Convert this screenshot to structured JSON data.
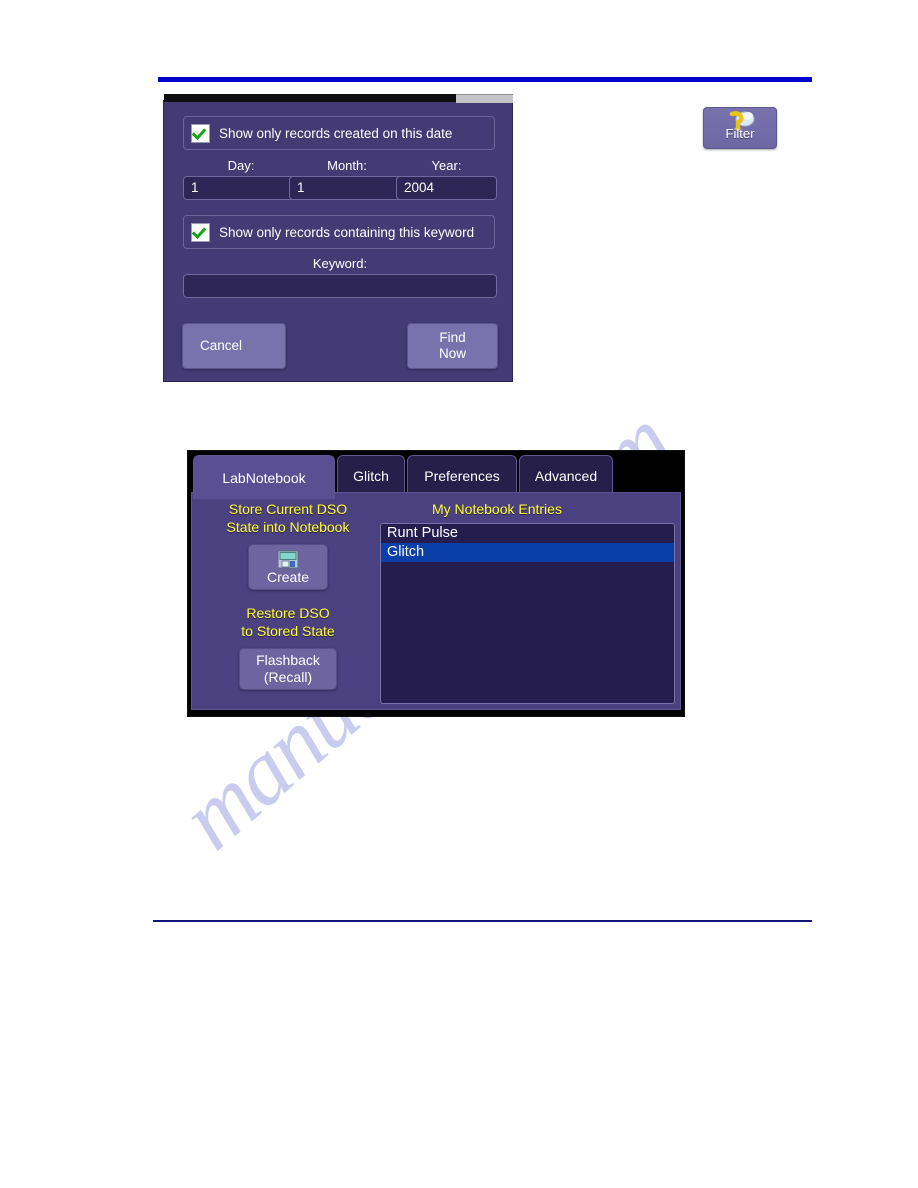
{
  "page": {
    "watermark_text": "manualshive.com",
    "rule_color_top": "#0000cc",
    "rule_color_bottom": "#141478"
  },
  "toolbar": {
    "filter_button": {
      "label": "Filter",
      "icon": "filter-question-icon"
    }
  },
  "find_dialog": {
    "date_checkbox": {
      "label": "Show only records created on this date",
      "checked": true
    },
    "date_fields": [
      {
        "label": "Day:",
        "value": "1"
      },
      {
        "label": "Month:",
        "value": "1"
      },
      {
        "label": "Year:",
        "value": "2004"
      }
    ],
    "keyword_checkbox": {
      "label": "Show only records containing this keyword",
      "checked": true
    },
    "keyword_field": {
      "label": "Keyword:",
      "value": ""
    },
    "buttons": {
      "cancel": "Cancel",
      "find_now": "Find\nNow",
      "find_now_line1": "Find",
      "find_now_line2": "Now"
    }
  },
  "notebook_panel": {
    "tabs": [
      {
        "label": "LabNotebook",
        "active": true
      },
      {
        "label": "Glitch",
        "active": false
      },
      {
        "label": "Preferences",
        "active": false
      },
      {
        "label": "Advanced",
        "active": false
      }
    ],
    "store_label_line1": "Store Current DSO",
    "store_label_line2": "State into Notebook",
    "create_button": {
      "label": "Create",
      "icon": "save-disk-icon"
    },
    "restore_label_line1": "Restore DSO",
    "restore_label_line2": "to Stored State",
    "flashback_button": {
      "line1": "Flashback",
      "line2": "(Recall)"
    },
    "list_title": "My Notebook Entries",
    "entries": [
      {
        "label": "Runt Pulse",
        "selected": false
      },
      {
        "label": "Glitch",
        "selected": true
      }
    ]
  }
}
